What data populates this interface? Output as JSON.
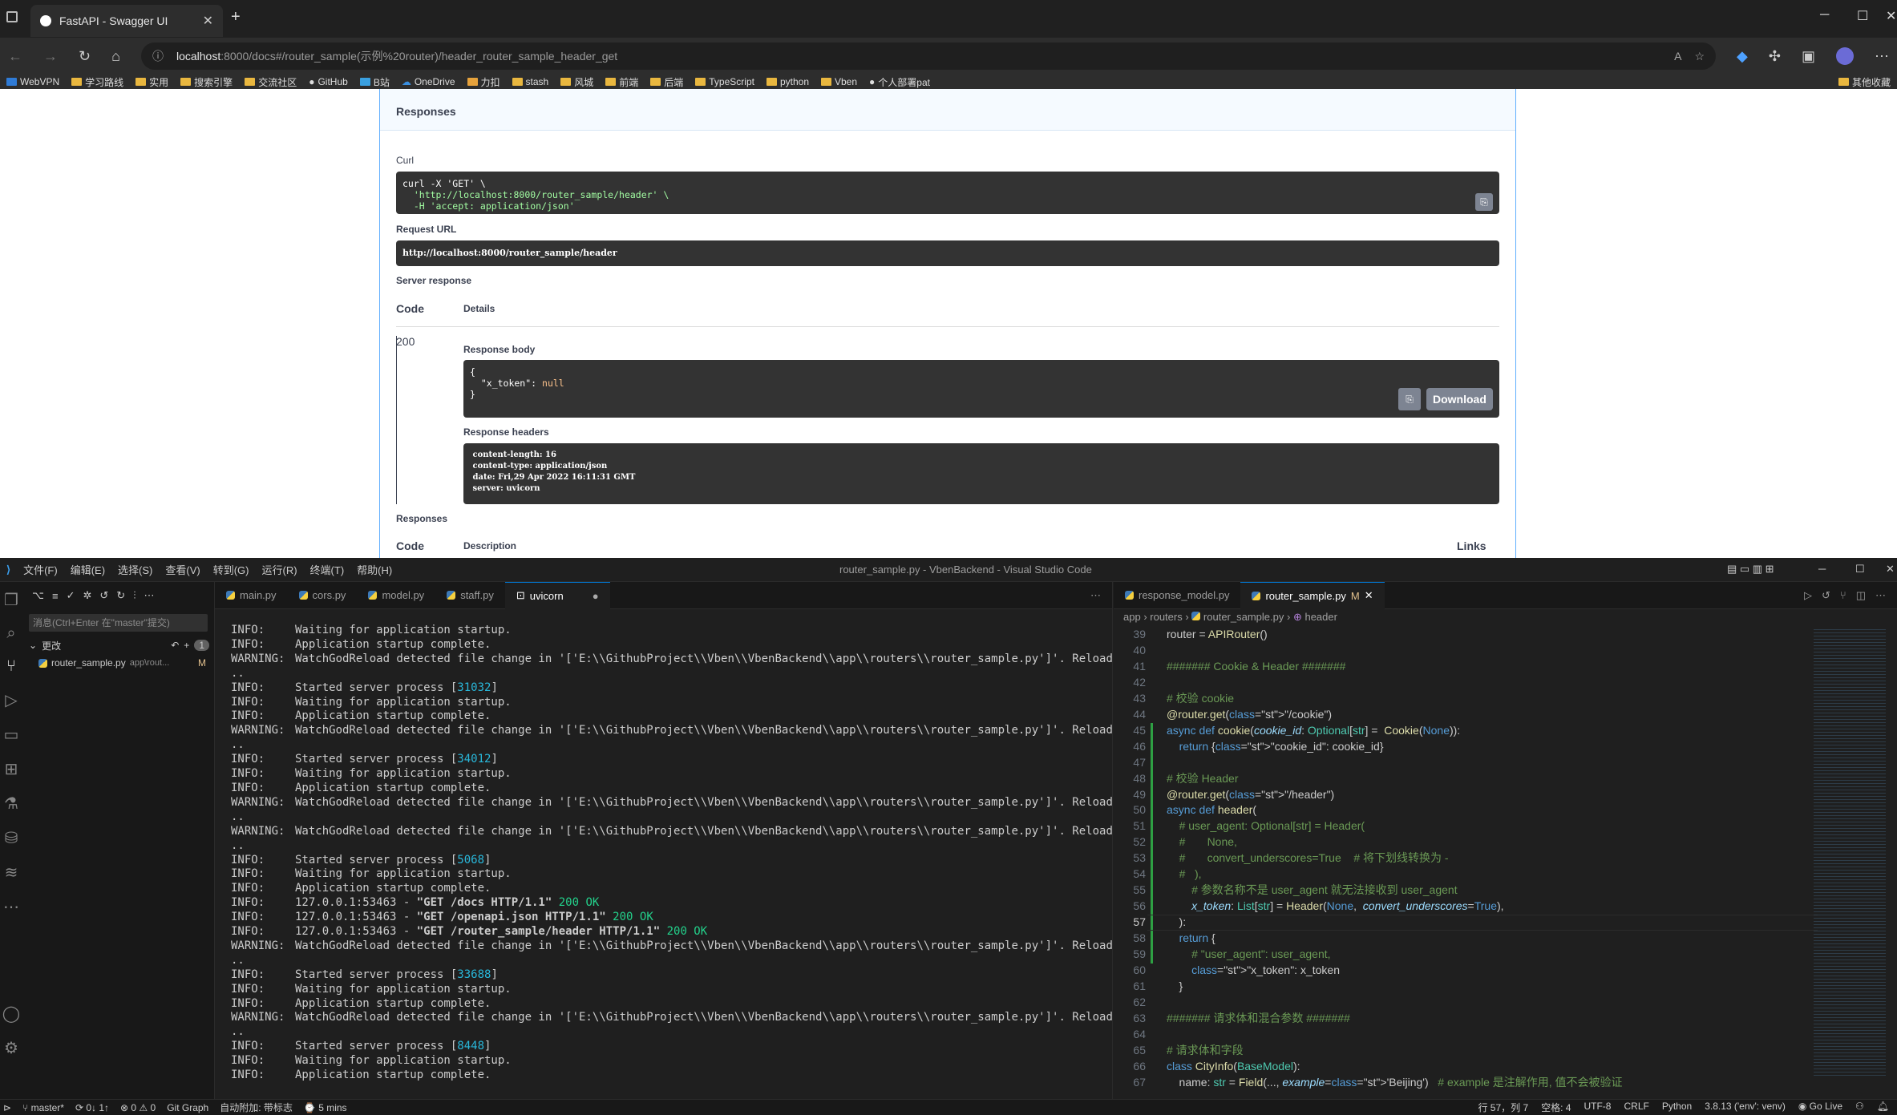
{
  "browser": {
    "tab_title": "FastAPI - Swagger UI",
    "url_host": "localhost",
    "url_rest": ":8000/docs#/router_sample(示例%20router)/header_router_sample_header_get",
    "bookmarks": [
      "WebVPN",
      "学习路线",
      "实用",
      "搜索引擎",
      "交流社区",
      "GitHub",
      "B站",
      "OneDrive",
      "力扣",
      "stash",
      "风城",
      "前端",
      "后端",
      "TypeScript",
      "python",
      "Vben",
      "个人部署pat"
    ],
    "bookmarks_other": "其他收藏"
  },
  "swagger": {
    "responses_heading": "Responses",
    "curl_label": "Curl",
    "curl_line1": "curl -X 'GET' \\",
    "curl_line2": "  'http://localhost:8000/router_sample/header' \\",
    "curl_line3": "  -H 'accept: application/json'",
    "request_url_label": "Request URL",
    "request_url": "http://localhost:8000/router_sample/header",
    "server_response_label": "Server response",
    "code_col": "Code",
    "details_col": "Details",
    "code_value": "200",
    "response_body_label": "Response body",
    "body_open": "{",
    "body_key": "  \"x_token\": ",
    "body_val": "null",
    "body_close": "}",
    "download_label": "Download",
    "response_headers_label": "Response headers",
    "headers": [
      " content-length: 16 ",
      " content-type: application/json ",
      " date: Fri,29 Apr 2022 16:11:31 GMT ",
      " server: uvicorn "
    ],
    "responses_heading2": "Responses",
    "code_col2": "Code",
    "description_col": "Description",
    "links_col": "Links"
  },
  "vscode": {
    "menu": [
      "文件(F)",
      "编辑(E)",
      "选择(S)",
      "查看(V)",
      "转到(G)",
      "运行(R)",
      "终端(T)",
      "帮助(H)"
    ],
    "window_title": "router_sample.py - VbenBackend - Visual Studio Code",
    "commit_placeholder": "消息(Ctrl+Enter 在\"master\"提交)",
    "changes_label": "更改",
    "changes_count": "1",
    "changed_file": "router_sample.py",
    "changed_path": "app\\rout...",
    "changed_status": "M",
    "term_tabs": [
      "main.py",
      "cors.py",
      "model.py",
      "staff.py",
      "uvicorn"
    ],
    "editor_tabs": [
      "response_model.py",
      "router_sample.py"
    ],
    "editor_tab_status": "M",
    "breadcrumb": [
      "app",
      "routers",
      "router_sample.py",
      "header"
    ],
    "status": {
      "branch": "master*",
      "sync": "0↓ 1↑",
      "problems": "⊗ 0 ⚠ 0",
      "gitgraph": "Git Graph",
      "autoattach": "自动附加: 带标志",
      "time": "5 mins",
      "position": "行 57，列 7",
      "spaces": "空格: 4",
      "encoding": "UTF-8",
      "eol": "CRLF",
      "lang": "Python",
      "interp": "3.8.13 ('env': venv)",
      "golive": "Go Live"
    }
  },
  "terminal_lines": [
    [
      "INFO:",
      "Waiting for application startup."
    ],
    [
      "INFO:",
      "Application startup complete."
    ],
    [
      "WARNING:",
      "WatchGodReload detected file change in '['E:\\\\GithubProject\\\\Vben\\\\VbenBackend\\\\app\\\\routers\\\\router_sample.py']'. Reloading."
    ],
    [
      "..",
      ""
    ],
    [
      "INFO:",
      "Started server process [31032]"
    ],
    [
      "INFO:",
      "Waiting for application startup."
    ],
    [
      "INFO:",
      "Application startup complete."
    ],
    [
      "WARNING:",
      "WatchGodReload detected file change in '['E:\\\\GithubProject\\\\Vben\\\\VbenBackend\\\\app\\\\routers\\\\router_sample.py']'. Reloading."
    ],
    [
      "..",
      ""
    ],
    [
      "INFO:",
      "Started server process [34012]"
    ],
    [
      "INFO:",
      "Waiting for application startup."
    ],
    [
      "INFO:",
      "Application startup complete."
    ],
    [
      "WARNING:",
      "WatchGodReload detected file change in '['E:\\\\GithubProject\\\\Vben\\\\VbenBackend\\\\app\\\\routers\\\\router_sample.py']'. Reloading."
    ],
    [
      "..",
      ""
    ],
    [
      "WARNING:",
      "WatchGodReload detected file change in '['E:\\\\GithubProject\\\\Vben\\\\VbenBackend\\\\app\\\\routers\\\\router_sample.py']'. Reloading."
    ],
    [
      "..",
      ""
    ],
    [
      "INFO:",
      "Started server process [5068]"
    ],
    [
      "INFO:",
      "Waiting for application startup."
    ],
    [
      "INFO:",
      "Application startup complete."
    ],
    [
      "INFO:",
      "127.0.0.1:53463 - \"GET /docs HTTP/1.1\" 200 OK"
    ],
    [
      "INFO:",
      "127.0.0.1:53463 - \"GET /openapi.json HTTP/1.1\" 200 OK"
    ],
    [
      "INFO:",
      "127.0.0.1:53463 - \"GET /router_sample/header HTTP/1.1\" 200 OK"
    ],
    [
      "WARNING:",
      "WatchGodReload detected file change in '['E:\\\\GithubProject\\\\Vben\\\\VbenBackend\\\\app\\\\routers\\\\router_sample.py']'. Reloading."
    ],
    [
      "..",
      ""
    ],
    [
      "INFO:",
      "Started server process [33688]"
    ],
    [
      "INFO:",
      "Waiting for application startup."
    ],
    [
      "INFO:",
      "Application startup complete."
    ],
    [
      "WARNING:",
      "WatchGodReload detected file change in '['E:\\\\GithubProject\\\\Vben\\\\VbenBackend\\\\app\\\\routers\\\\router_sample.py']'. Reloading."
    ],
    [
      "..",
      ""
    ],
    [
      "INFO:",
      "Started server process [8448]"
    ],
    [
      "INFO:",
      "Waiting for application startup."
    ],
    [
      "INFO:",
      "Application startup complete."
    ]
  ],
  "editor_line_numbers": [
    "39",
    "40",
    "41",
    "42",
    "43",
    "44",
    "45",
    "46",
    "47",
    "48",
    "49",
    "50",
    "51",
    "52",
    "53",
    "54",
    "55",
    "56",
    "57",
    "58",
    "59",
    "60",
    "61",
    "62",
    "63",
    "64",
    "65",
    "66",
    "67"
  ],
  "code_lines": [
    "router = APIRouter()",
    "",
    "####### Cookie & Header #######",
    "",
    "# 校验 cookie",
    "@router.get(\"/cookie\")",
    "async def cookie(cookie_id: Optional[str] =  Cookie(None)):",
    "    return {\"cookie_id\": cookie_id}",
    "",
    "# 校验 Header",
    "@router.get(\"/header\")",
    "async def header(",
    "    # user_agent: Optional[str] = Header(",
    "    #       None,",
    "    #       convert_underscores=True    # 将下划线转换为 -",
    "    #   ),",
    "        # 参数名称不是 user_agent 就无法接收到 user_agent",
    "        x_token: List[str] = Header(None,  convert_underscores=True),",
    "    ):",
    "    return {",
    "        # \"user_agent\": user_agent,",
    "        \"x_token\": x_token",
    "    }",
    "",
    "####### 请求体和混合参数 #######",
    "",
    "# 请求体和字段",
    "class CityInfo(BaseModel):",
    "    name: str = Field(..., example='Beijing')   # example 是注解作用, 值不会被验证"
  ]
}
